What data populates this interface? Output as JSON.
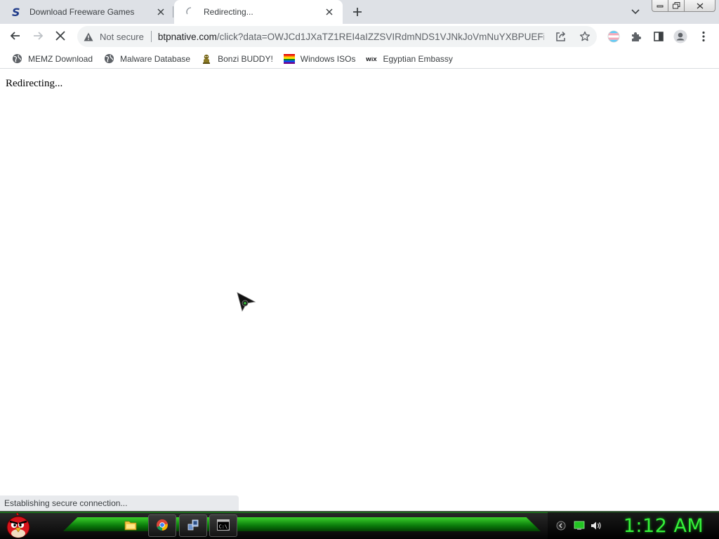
{
  "browser": {
    "tabs": [
      {
        "title": "Download Freeware Games",
        "favicon": "softonic-s-icon",
        "active": false
      },
      {
        "title": "Redirecting...",
        "favicon": "loading-spinner-icon",
        "active": true
      }
    ],
    "window_controls": [
      "minimize",
      "restore",
      "close"
    ]
  },
  "toolbar": {
    "security_label": "Not secure",
    "url_host": "btpnative.com",
    "url_rest": "/click?data=OWJCd1JXaTZ1REI4aIZZSVIRdmNDS1VJNkJoVmNuYXBPUEFi..."
  },
  "bookmarks": [
    {
      "label": "MEMZ Download",
      "icon": "globe-icon"
    },
    {
      "label": "Malware Database",
      "icon": "globe-icon"
    },
    {
      "label": "Bonzi BUDDY!",
      "icon": "bonzi-icon"
    },
    {
      "label": "Windows ISOs",
      "icon": "rainbow-flag-icon"
    },
    {
      "label": "Egyptian Embassy",
      "icon": "wix-icon"
    }
  ],
  "page": {
    "body_text": "Redirecting..."
  },
  "status": {
    "text": "Establishing secure connection..."
  },
  "taskbar": {
    "clock": "1:12 AM",
    "pinned": [
      "explorer-folder-icon",
      "chrome-icon",
      "network-app-icon",
      "cmd-icon"
    ],
    "active_app": "chrome-icon"
  },
  "colors": {
    "tabstrip": "#dee1e6",
    "clock_green": "#35f03a",
    "taskbar_green": "#1aa51a"
  }
}
